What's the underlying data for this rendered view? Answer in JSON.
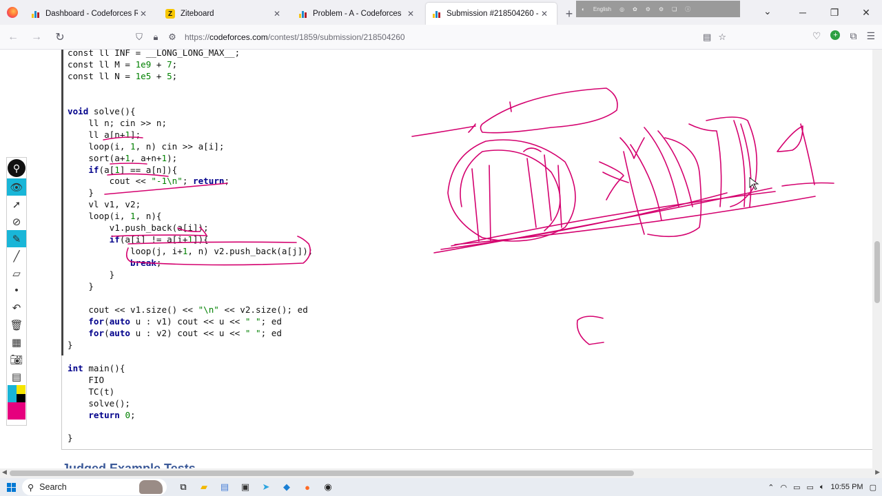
{
  "browser": {
    "tabs": [
      {
        "title": "Dashboard - Codeforces Round",
        "icon": "codeforces-icon",
        "active": false
      },
      {
        "title": "Ziteboard",
        "icon": "ziteboard-icon",
        "active": false
      },
      {
        "title": "Problem - A - Codeforces",
        "icon": "codeforces-icon",
        "active": false
      },
      {
        "title": "Submission #218504260 - Code",
        "icon": "codeforces-icon",
        "active": true
      }
    ],
    "url_prefix": "https://",
    "url_domain": "codeforces.com",
    "url_path": "/contest/1859/submission/218504260",
    "overlay_toolbar_label": "English"
  },
  "code": {
    "lines": [
      "const ll INF = __LONG_LONG_MAX__;",
      "const ll M = 1e9 + 7;",
      "const ll N = 1e5 + 5;",
      "",
      "",
      "void solve(){",
      "    ll n; cin >> n;",
      "    ll a[n+1];",
      "    loop(i, 1, n) cin >> a[i];",
      "    sort(a+1, a+n+1);",
      "    if(a[1] == a[n]){",
      "        cout << \"-1\\n\"; return;",
      "    }",
      "    vl v1, v2;",
      "    loop(i, 1, n){",
      "        v1.push_back(a[i]);",
      "        if(a[i] != a[i+1]){",
      "            loop(j, i+1, n) v2.push_back(a[j]);",
      "            break;",
      "        }",
      "    }",
      "",
      "    cout << v1.size() << \"\\n\" << v2.size(); ed",
      "    for(auto u : v1) cout << u << \" \"; ed",
      "    for(auto u : v2) cout << u << \" \"; ed",
      "}",
      "",
      "int main(){",
      "    FIO",
      "    TC(t)",
      "    solve();",
      "    return 0;",
      "",
      "}"
    ]
  },
  "section_heading": "Judged Example Tests",
  "annotation_tools": [
    "logo-icon",
    "eye-icon",
    "pointer-icon",
    "no-draw-icon",
    "highlighter-icon",
    "pen-icon",
    "eraser-icon",
    "dot-icon",
    "undo-icon",
    "trash-icon",
    "whiteboard-icon",
    "camera-icon",
    "notes-icon"
  ],
  "palette_colors": [
    "#18b4d6",
    "#f5e500",
    "#18b4d6",
    "#000000",
    "#e6007e"
  ],
  "ink_color": "#d4006e",
  "taskbar": {
    "search_placeholder": "Search",
    "time": "10:55 PM"
  }
}
